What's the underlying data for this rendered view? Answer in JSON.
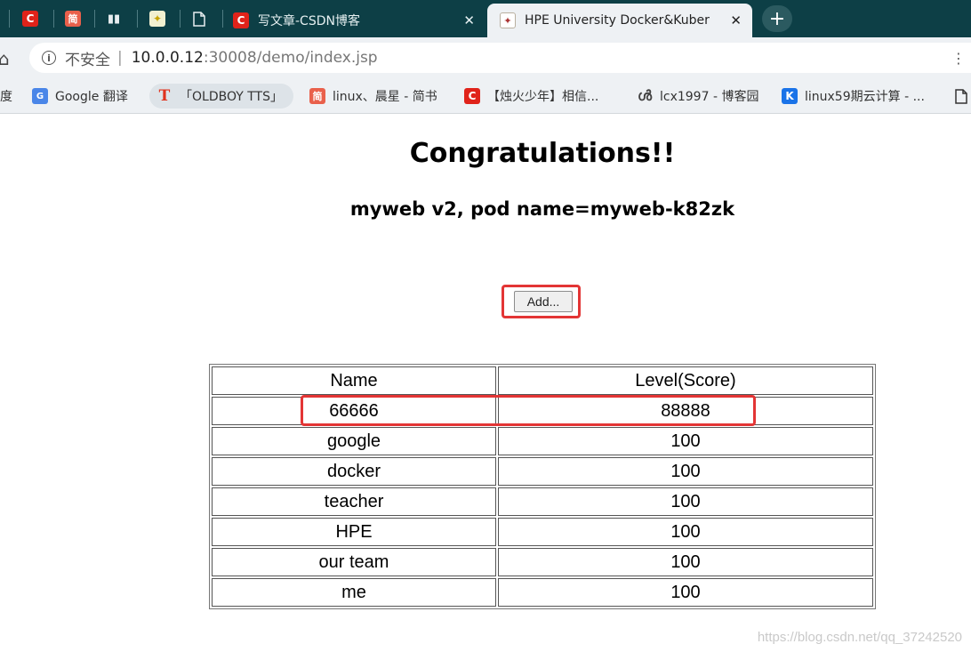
{
  "tabs": {
    "active_title": "HPE University Docker&Kuber",
    "csdn_title": "写文章-CSDN博客",
    "close_glyph": "✕",
    "new_tab_glyph": "+"
  },
  "address_bar": {
    "security_label": "不安全",
    "separator": "|",
    "url_host": "10.0.0.12",
    "url_rest": ":30008/demo/index.jsp"
  },
  "bookmarks": [
    {
      "label": "度",
      "icon": "text-clipped"
    },
    {
      "label": "Google 翻译",
      "icon": "google-translate-icon"
    },
    {
      "label": "「OLDBOY TTS」",
      "icon": "t-icon"
    },
    {
      "label": "linux、晨星 - 简书",
      "icon": "jianshu-icon"
    },
    {
      "label": "【烛火少年】相信...",
      "icon": "csdn-icon"
    },
    {
      "label": "lcx1997 - 博客园",
      "icon": "cnblogs-icon"
    },
    {
      "label": "linux59期云计算 - ...",
      "icon": "k-icon"
    }
  ],
  "page": {
    "heading": "Congratulations!!",
    "subheading": "myweb v2, pod name=myweb-k82zk",
    "add_button_label": "Add...",
    "table": {
      "headers": [
        "Name",
        "Level(Score)"
      ],
      "rows": [
        [
          "66666",
          "88888"
        ],
        [
          "google",
          "100"
        ],
        [
          "docker",
          "100"
        ],
        [
          "teacher",
          "100"
        ],
        [
          "HPE",
          "100"
        ],
        [
          "our team",
          "100"
        ],
        [
          "me",
          "100"
        ]
      ]
    }
  },
  "watermark": "https://blog.csdn.net/qq_37242520",
  "colors": {
    "tab_strip": "#0d3f46",
    "annotation_red": "#e33535",
    "csdn_red": "#e0231a"
  }
}
